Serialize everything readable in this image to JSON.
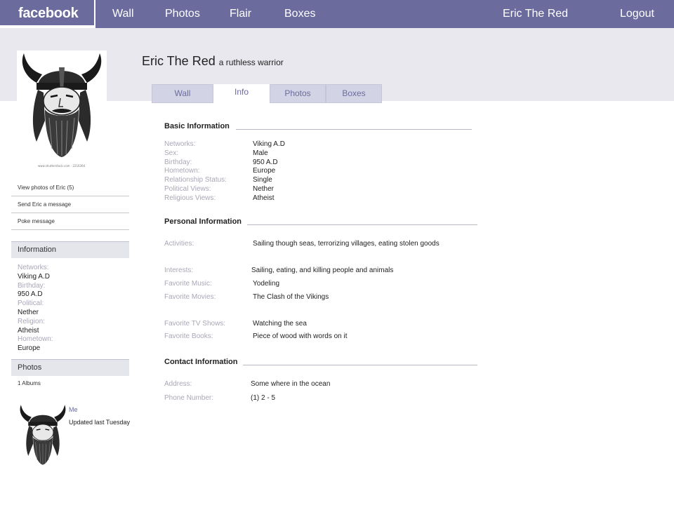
{
  "nav": {
    "logo": "facebook",
    "items": [
      "Wall",
      "Photos",
      "Flair",
      "Boxes"
    ],
    "user": "Eric The Red",
    "logout": "Logout"
  },
  "profile": {
    "name": "Eric The Red",
    "tagline": "a ruthless warrior"
  },
  "tabs": [
    {
      "label": "Wall",
      "active": false
    },
    {
      "label": "Info",
      "active": true
    },
    {
      "label": "Photos",
      "active": false
    },
    {
      "label": "Boxes",
      "active": false
    }
  ],
  "sidebar": {
    "links": [
      "View photos of Eric (5)",
      "Send Eric a message",
      "Poke message"
    ],
    "information_header": "Information",
    "information": [
      {
        "label": "Networks:",
        "value": "Viking A.D"
      },
      {
        "label": "Birthday:",
        "value": "950 A.D"
      },
      {
        "label": "Political:",
        "value": "Nether"
      },
      {
        "label": "Religion:",
        "value": "Atheist"
      },
      {
        "label": "Hometown:",
        "value": "Europe"
      }
    ],
    "photos_header": "Photos",
    "albums": "1 Albums",
    "mini_title": "Me",
    "mini_updated": "Updated last Tuesday"
  },
  "basic": {
    "title": "Basic Information",
    "rows": [
      {
        "label": "Networks:",
        "value": "Viking A.D"
      },
      {
        "label": "Sex:",
        "value": "Male"
      },
      {
        "label": "Birthday:",
        "value": "950 A.D"
      },
      {
        "label": "Hometown:",
        "value": "Europe"
      },
      {
        "label": "Relationship Status:",
        "value": "Single"
      },
      {
        "label": "Political Views:",
        "value": "Nether"
      },
      {
        "label": "Religious Views:",
        "value": "Atheist"
      }
    ]
  },
  "personal": {
    "title": "Personal Information",
    "activities_label": "Activities:",
    "activities": "Sailing though seas, terrorizing villages, eating stolen goods",
    "interests_label": "Interests:",
    "interests": "Sailing, eating, and killing people and animals",
    "music_label": "Favorite Music:",
    "music": "Yodeling",
    "movies_label": "Favorite Movies:",
    "movies": "The Clash of the Vikings",
    "tv_label": "Favorite TV Shows:",
    "tv": "Watching the sea",
    "books_label": "Favorite Books:",
    "books": "Piece of wood with words on it"
  },
  "contact": {
    "title": "Contact Information",
    "address_label": "Address:",
    "address": "Some where in the ocean",
    "phone_label": "Phone Number:",
    "phone": "(1) 2 - 5"
  }
}
